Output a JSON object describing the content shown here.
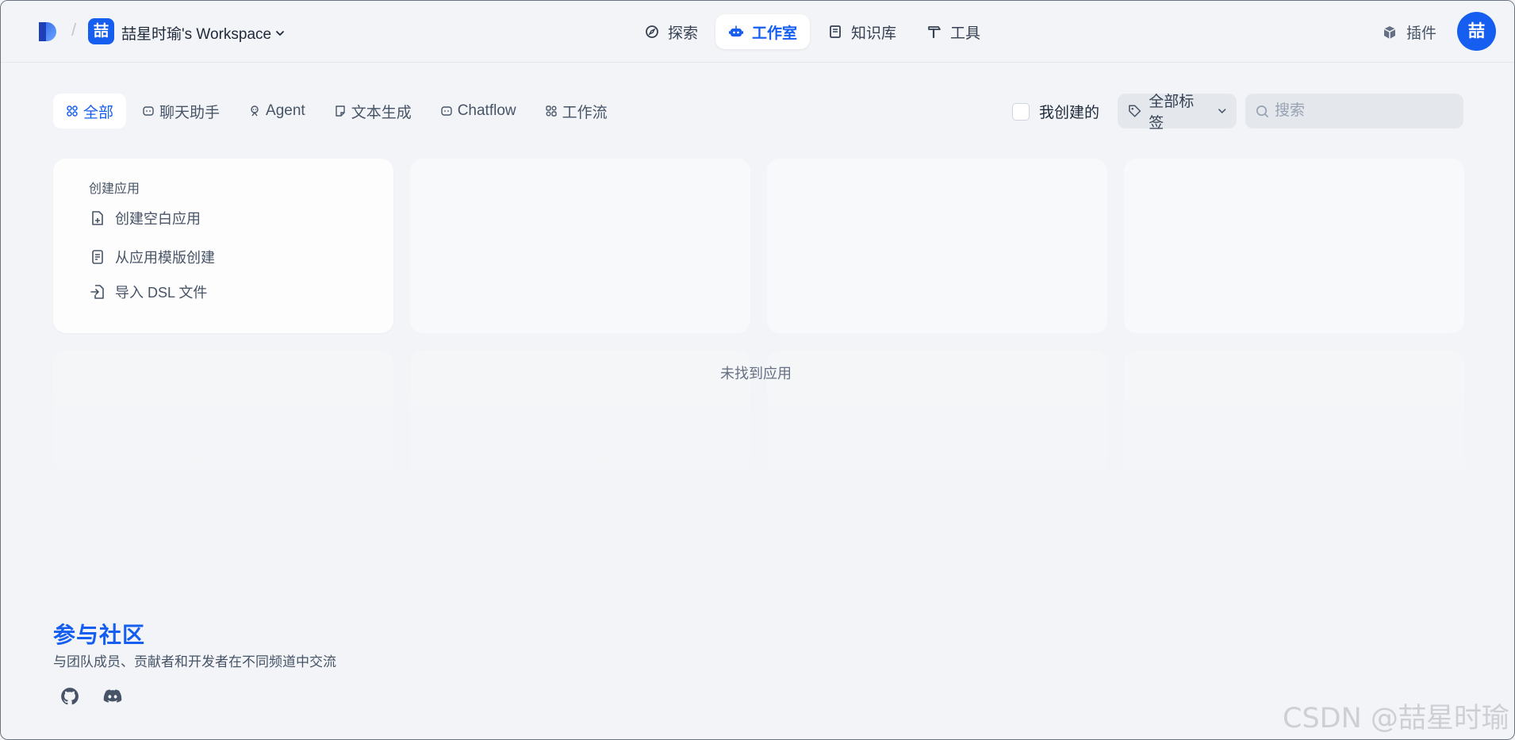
{
  "header": {
    "workspace_badge": "喆",
    "workspace_name": "喆星时瑜's Workspace",
    "nav": [
      {
        "label": "探索",
        "icon": "compass-icon"
      },
      {
        "label": "工作室",
        "icon": "robot-icon",
        "active": true
      },
      {
        "label": "知识库",
        "icon": "book-icon"
      },
      {
        "label": "工具",
        "icon": "hammer-icon"
      }
    ],
    "plugins_label": "插件",
    "avatar_text": "喆"
  },
  "filters": {
    "tabs": [
      {
        "label": "全部",
        "icon": "grid-icon",
        "active": true
      },
      {
        "label": "聊天助手",
        "icon": "chat-bubble-icon"
      },
      {
        "label": "Agent",
        "icon": "agent-icon"
      },
      {
        "label": "文本生成",
        "icon": "note-icon"
      },
      {
        "label": "Chatflow",
        "icon": "chatflow-icon"
      },
      {
        "label": "工作流",
        "icon": "workflow-icon"
      }
    ],
    "created_by_me_label": "我创建的",
    "created_by_me_checked": false,
    "tags_label": "全部标签",
    "search_placeholder": "搜索",
    "search_value": ""
  },
  "create_card": {
    "title": "创建应用",
    "items": [
      {
        "label": "创建空白应用",
        "icon": "file-plus-icon"
      },
      {
        "label": "从应用模版创建",
        "icon": "template-icon"
      },
      {
        "label": "导入 DSL 文件",
        "icon": "import-file-icon"
      }
    ]
  },
  "empty_message": "未找到应用",
  "community": {
    "title": "参与社区",
    "subtitle": "与团队成员、贡献者和开发者在不同频道中交流",
    "links": [
      {
        "icon": "github-icon"
      },
      {
        "icon": "discord-icon"
      }
    ]
  },
  "watermark": "CSDN @喆星时瑜",
  "colors": {
    "accent": "#155eef",
    "background": "#f2f4f7",
    "text": "#354052"
  }
}
